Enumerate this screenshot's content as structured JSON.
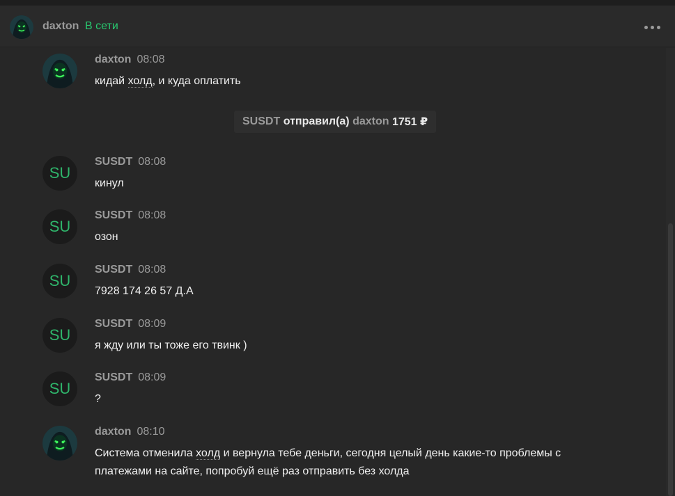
{
  "chat": {
    "name": "daxton",
    "status": "В сети",
    "status_color": "#28c76f",
    "more_icon": "more-horizontal-icon"
  },
  "system_message": {
    "sender": "SUSDT",
    "action": "отправил(а)",
    "recipient": "daxton",
    "amount": "1751 ₽"
  },
  "messages": [
    {
      "author": "daxton",
      "time": "08:08",
      "text_before": "кидай ",
      "text_hl": "холд",
      "text_after": ", и куда оплатить"
    },
    {
      "author": "SUSDT",
      "avatar_text": "SU",
      "time": "08:08",
      "text": "кинул"
    },
    {
      "author": "SUSDT",
      "avatar_text": "SU",
      "time": "08:08",
      "text": "озон"
    },
    {
      "author": "SUSDT",
      "avatar_text": "SU",
      "time": "08:08",
      "text": "7928 174 26 57 Д.А"
    },
    {
      "author": "SUSDT",
      "avatar_text": "SU",
      "time": "08:09",
      "text": "я жду или ты тоже его твинк )"
    },
    {
      "author": "SUSDT",
      "avatar_text": "SU",
      "time": "08:09",
      "text": "?"
    },
    {
      "author": "daxton",
      "time": "08:10",
      "text_before": "Система отменила ",
      "text_hl": "холд",
      "text_after": " и вернула тебе деньги, сегодня целый день какие-то проблемы с платежами на сайте, попробуй ещё раз отправить без холда"
    }
  ]
}
